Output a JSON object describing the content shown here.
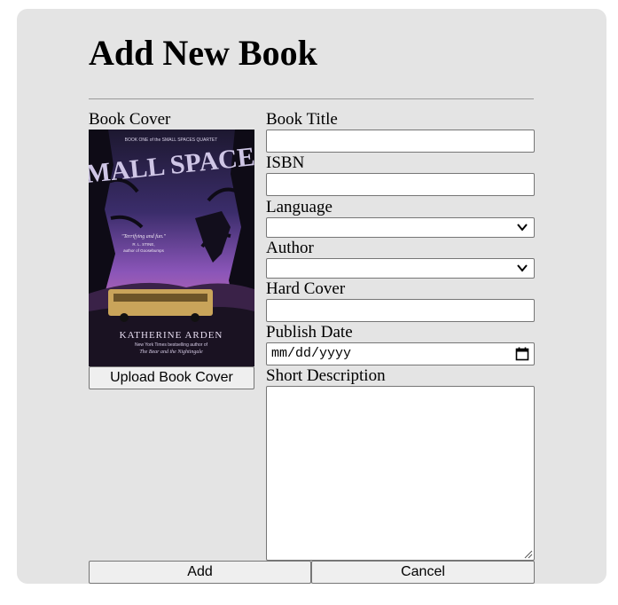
{
  "page": {
    "title": "Add New Book"
  },
  "cover": {
    "label": "Book Cover",
    "upload_label": "Upload Book Cover",
    "image": {
      "series_line": "BOOK ONE of the SMALL SPACES QUARTET",
      "title_art": "SMALL SPACES",
      "quote": "\"Terrifying and fun.\"",
      "quote_author": "R. L. STINE,",
      "quote_source": "author of Goosebumps",
      "author": "KATHERINE ARDEN",
      "byline_1": "New York Times bestselling author of",
      "byline_2": "The Bear and the Nightingale"
    }
  },
  "form": {
    "title_label": "Book Title",
    "title_value": "",
    "isbn_label": "ISBN",
    "isbn_value": "",
    "language_label": "Language",
    "language_value": "",
    "author_label": "Author",
    "author_value": "",
    "hardcover_label": "Hard Cover",
    "hardcover_value": "",
    "publish_date_label": "Publish Date",
    "publish_date_placeholder": "mm/dd/yyyy",
    "description_label": "Short Description",
    "description_value": ""
  },
  "actions": {
    "add_label": "Add",
    "cancel_label": "Cancel"
  },
  "icons": {
    "select_arrow": "chevron-down-icon",
    "date_picker": "calendar-icon",
    "resize": "resize-grip-icon"
  },
  "colors": {
    "panel_bg": "#e4e4e4",
    "input_border": "#767676",
    "button_bg": "#efefef"
  }
}
